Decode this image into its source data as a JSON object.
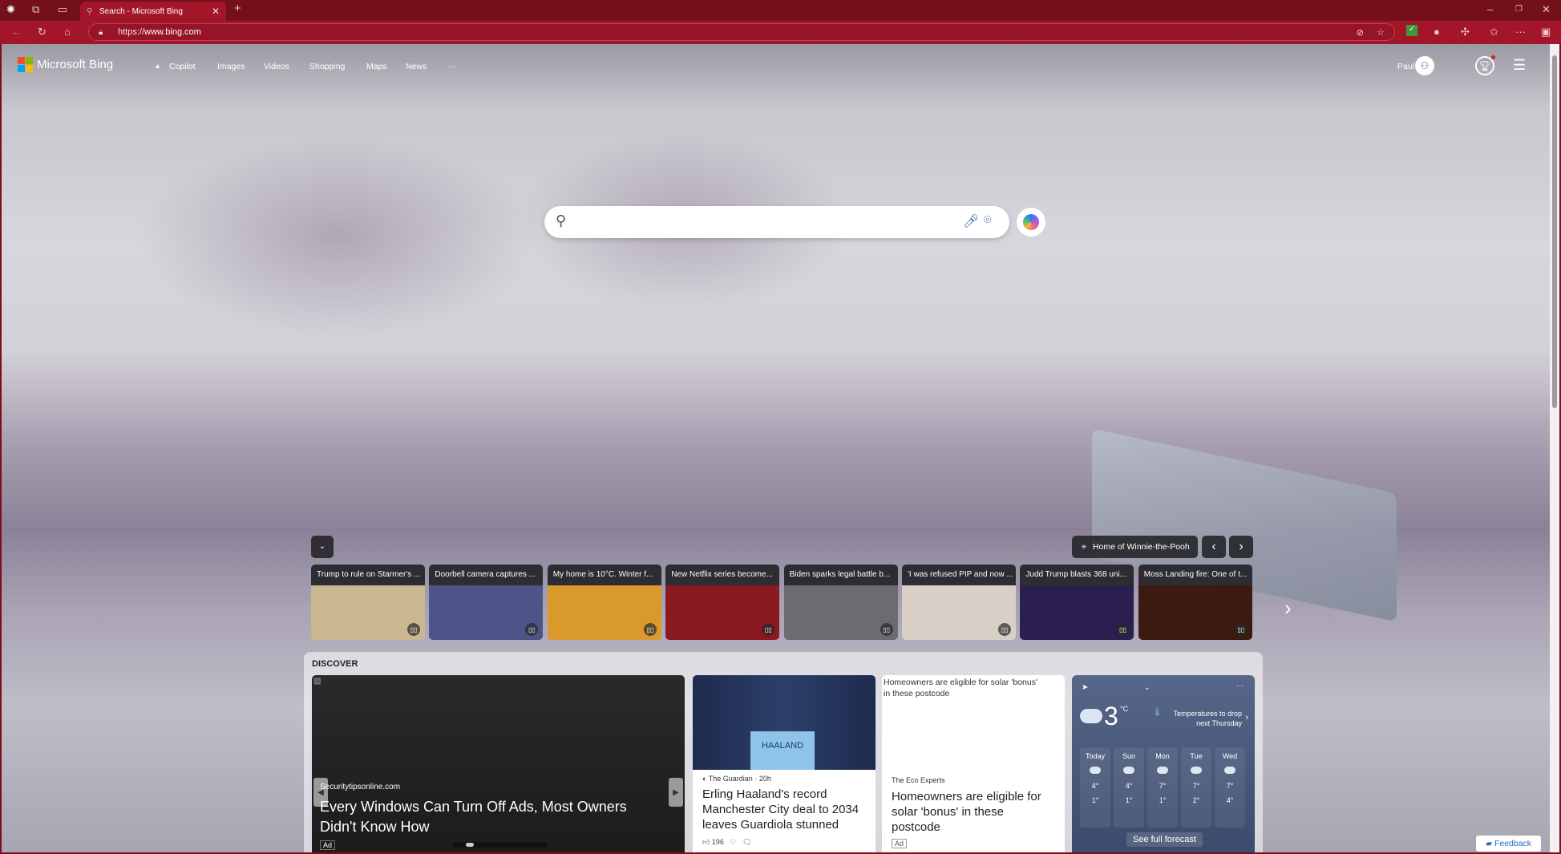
{
  "browser": {
    "tab_title": "Search - Microsoft Bing",
    "url_prefix": "https://",
    "url_host": "www.bing.com"
  },
  "nav": {
    "logo": "Microsoft Bing",
    "links": [
      "Copilot",
      "Images",
      "Videos",
      "Shopping",
      "Maps",
      "News"
    ],
    "more": "···",
    "user": "Paul"
  },
  "search": {
    "placeholder": ""
  },
  "location": {
    "label": "Home of Winnie-the-Pooh"
  },
  "news": [
    {
      "title": "Trump to rule on Starmer's ...",
      "color": "#c9b890"
    },
    {
      "title": "Doorbell camera captures ...",
      "color": "#4d5487"
    },
    {
      "title": "My home is 10°C. Winter f...",
      "color": "#d9992b"
    },
    {
      "title": "New Netflix series become...",
      "color": "#8a1a1f"
    },
    {
      "title": "Biden sparks legal battle b...",
      "color": "#6d6a70"
    },
    {
      "title": "'I was refused PIP and now ...",
      "color": "#d8cfc6"
    },
    {
      "title": "Judd Trump blasts 368 uni...",
      "color": "#2a1f4f"
    },
    {
      "title": "Moss Landing fire: One of t...",
      "color": "#3b1a10"
    }
  ],
  "discover": {
    "label": "DISCOVER",
    "ad": {
      "source": "Securitytipsonline.com",
      "title": "Every Windows Can Turn Off Ads, Most Owners Didn't Know How",
      "badge": "Ad"
    },
    "story": {
      "source": "The Guardian",
      "age": "· 20h",
      "title": "Erling Haaland's record Manchester City deal to 2034 leaves Guardiola stunned",
      "likes": "196",
      "image_text": "HAALAND"
    },
    "promo": {
      "alt": "Homeowners are eligible for solar 'bonus' in these postcode",
      "source": "The Eco Experts",
      "title": "Homeowners are eligible for solar 'bonus' in these postcode",
      "badge": "Ad"
    }
  },
  "weather": {
    "temp": "3",
    "unit": "°C",
    "alert": "Temperatures to drop next Thursday",
    "more": "···",
    "full": "See full forecast",
    "days": [
      {
        "d": "Today",
        "hi": "4°",
        "lo": "1°"
      },
      {
        "d": "Sun",
        "hi": "4°",
        "lo": "1°"
      },
      {
        "d": "Mon",
        "hi": "7°",
        "lo": "1°"
      },
      {
        "d": "Tue",
        "hi": "7°",
        "lo": "2°"
      },
      {
        "d": "Wed",
        "hi": "7°",
        "lo": "4°"
      }
    ]
  },
  "feedback": "Feedback",
  "colors": {
    "frame": "#a3162a",
    "weather": "#3b4a6a"
  }
}
